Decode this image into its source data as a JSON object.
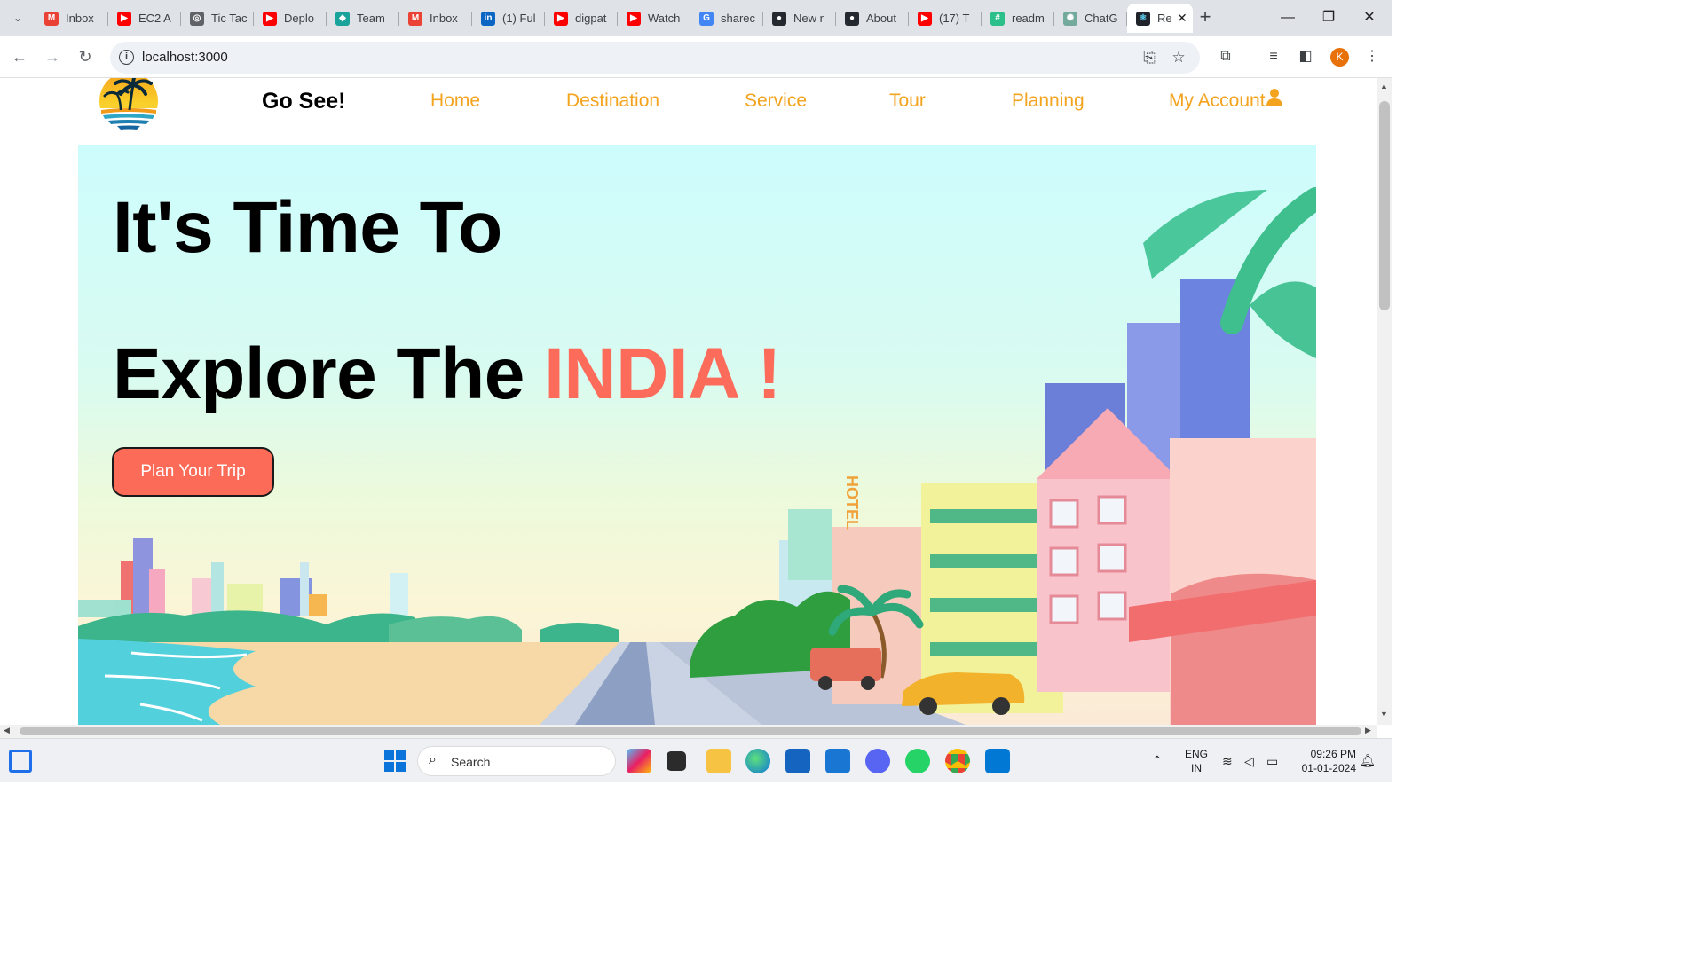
{
  "browser": {
    "tabs": [
      {
        "title": "Inbox",
        "icon": "gmail-icon",
        "color": "#ea4335"
      },
      {
        "title": "EC2 A",
        "icon": "youtube-icon",
        "color": "#ff0000"
      },
      {
        "title": "Tic Tac",
        "icon": "globe-icon",
        "color": "#5f6368"
      },
      {
        "title": "Deplo",
        "icon": "youtube-icon",
        "color": "#ff0000"
      },
      {
        "title": "Team",
        "icon": "diamond-icon",
        "color": "#1aa39a"
      },
      {
        "title": "Inbox",
        "icon": "gmail-icon",
        "color": "#ea4335"
      },
      {
        "title": "(1) Ful",
        "icon": "linkedin-icon",
        "color": "#0a66c2"
      },
      {
        "title": "digpat",
        "icon": "youtube-icon",
        "color": "#ff0000"
      },
      {
        "title": "Watch",
        "icon": "youtube-icon",
        "color": "#ff0000"
      },
      {
        "title": "sharec",
        "icon": "google-icon",
        "color": "#4285f4"
      },
      {
        "title": "New r",
        "icon": "github-icon",
        "color": "#24292f"
      },
      {
        "title": "About",
        "icon": "github-icon",
        "color": "#24292f"
      },
      {
        "title": "(17) T",
        "icon": "youtube-icon",
        "color": "#ff0000"
      },
      {
        "title": "readm",
        "icon": "grid-icon",
        "color": "#2bbf8a"
      },
      {
        "title": "ChatG",
        "icon": "chatgpt-icon",
        "color": "#74aa9c"
      }
    ],
    "active_tab": {
      "title": "Re",
      "icon": "react-icon"
    },
    "url": "localhost:3000",
    "profile_initial": "K"
  },
  "site": {
    "brand": "Go See!",
    "nav": [
      "Home",
      "Destination",
      "Service",
      "Tour",
      "Planning",
      "My Account"
    ],
    "nav_color": "#f3a31e",
    "hero": {
      "line1": "It's Time To",
      "line2_prefix": "Explore The",
      "line2_accent": "INDIA !",
      "accent_color": "#fd6b5a",
      "cta": "Plan Your Trip"
    }
  },
  "taskbar": {
    "search_label": "Search",
    "lang_top": "ENG",
    "lang_bottom": "IN",
    "time": "09:26 PM",
    "date": "01-01-2024"
  }
}
